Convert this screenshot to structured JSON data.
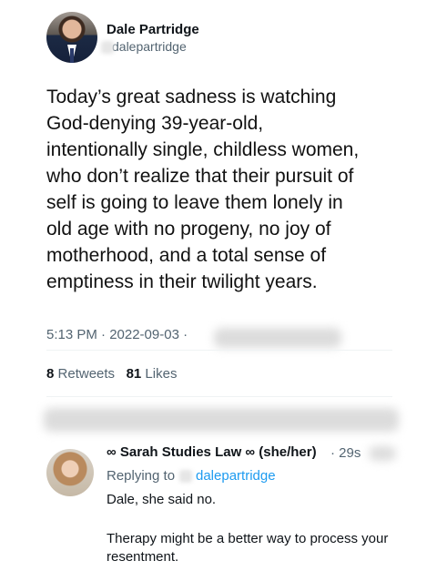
{
  "tweet": {
    "author_name": "Dale Partridge",
    "author_handle": "dalepartridge",
    "text": "Today’s great sadness is watching\nGod-denying 39-year-old,\nintentionally single, childless women,\nwho don’t realize that their pursuit of\nself is going to leave them lonely in\nold age with no progeny, no joy of\nmotherhood, and a total sense of\nemptiness in their twilight years.",
    "time": "5:13 PM · 2022-09-03 ·",
    "retweets_count": "8",
    "retweets_label": "Retweets",
    "likes_count": "81",
    "likes_label": "Likes"
  },
  "reply": {
    "author_name": "∞ Sarah Studies Law ∞ (she/her)",
    "time": "· 29s",
    "replying_to_label": "Replying to",
    "replying_to_handle": "dalepartridge",
    "line1": "Dale, she said no.",
    "line2": "Therapy might be a better way to process your resentment."
  }
}
